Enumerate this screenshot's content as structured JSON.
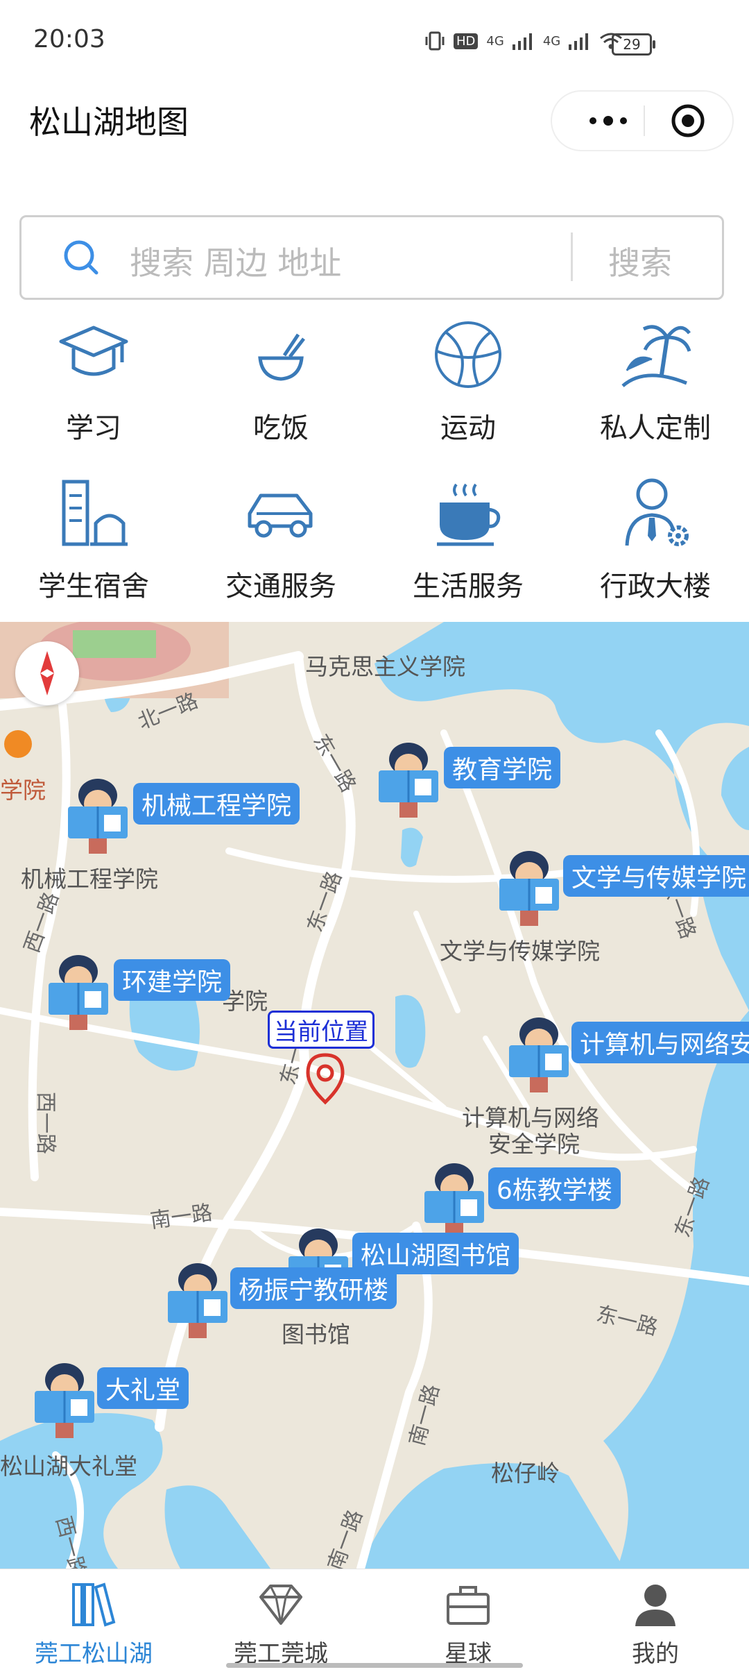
{
  "status_bar": {
    "time": "20:03",
    "network_a": "4G",
    "network_b": "4G",
    "hd": "HD",
    "battery": "29"
  },
  "header": {
    "title": "松山湖地图"
  },
  "search": {
    "placeholder": "搜索 周边 地址",
    "button": "搜索"
  },
  "categories": [
    {
      "label": "学习",
      "icon": "graduation-cap-icon"
    },
    {
      "label": "吃饭",
      "icon": "bowl-icon"
    },
    {
      "label": "运动",
      "icon": "basketball-icon"
    },
    {
      "label": "私人定制",
      "icon": "palm-island-icon"
    },
    {
      "label": "学生宿舍",
      "icon": "dorm-building-icon"
    },
    {
      "label": "交通服务",
      "icon": "car-icon"
    },
    {
      "label": "生活服务",
      "icon": "coffee-cup-icon"
    },
    {
      "label": "行政大楼",
      "icon": "admin-person-icon"
    }
  ],
  "map": {
    "place_labels": {
      "marxism": "马克思主义学院",
      "xueyuan_left": "学院",
      "jixie": "机械工程学院",
      "wenxue": "文学与传媒学院",
      "env_part": "学院",
      "jisuanji_1": "计算机与网络",
      "jisuanji_2": "安全学院",
      "library": "图书馆",
      "auditorium": "松山湖大礼堂",
      "songzailing": "松仔岭"
    },
    "road_labels": {
      "bei_yi": "北一路",
      "dong_yi_a": "东一路",
      "dong_yi_b": "东一路",
      "dong_yi_c": "东一路",
      "xi_yi_a": "西一路",
      "xi_yi_b": "西一路",
      "xi_yi_c": "西一路",
      "nan_yi_a": "南一路",
      "nan_yi_b": "南一路",
      "nan_yi_c": "南一路",
      "dong_yi_d": "东一路",
      "dong_yi_e": "东一路",
      "dong_yi_f": "东一路"
    },
    "markers": {
      "jiaoyu": "教育学院",
      "jixie": "机械工程学院",
      "wenxue": "文学与传媒学院",
      "huanjian": "环建学院",
      "jisuanji": "计算机与网络安",
      "liudong": "6栋教学楼",
      "library": "松山湖图书馆",
      "yangzhenning": "杨振宁教研楼",
      "dalitang": "大礼堂"
    },
    "current_location": "当前位置",
    "colors": {
      "water": "#93d3f3",
      "land": "#ece7db",
      "road": "#ffffff",
      "marker": "#3d8fe6"
    }
  },
  "tabbar": [
    {
      "label": "莞工松山湖",
      "icon": "books-icon",
      "active": true
    },
    {
      "label": "莞工莞城",
      "icon": "diamond-icon",
      "active": false
    },
    {
      "label": "星球",
      "icon": "briefcase-icon",
      "active": false
    },
    {
      "label": "我的",
      "icon": "person-icon",
      "active": false
    }
  ]
}
